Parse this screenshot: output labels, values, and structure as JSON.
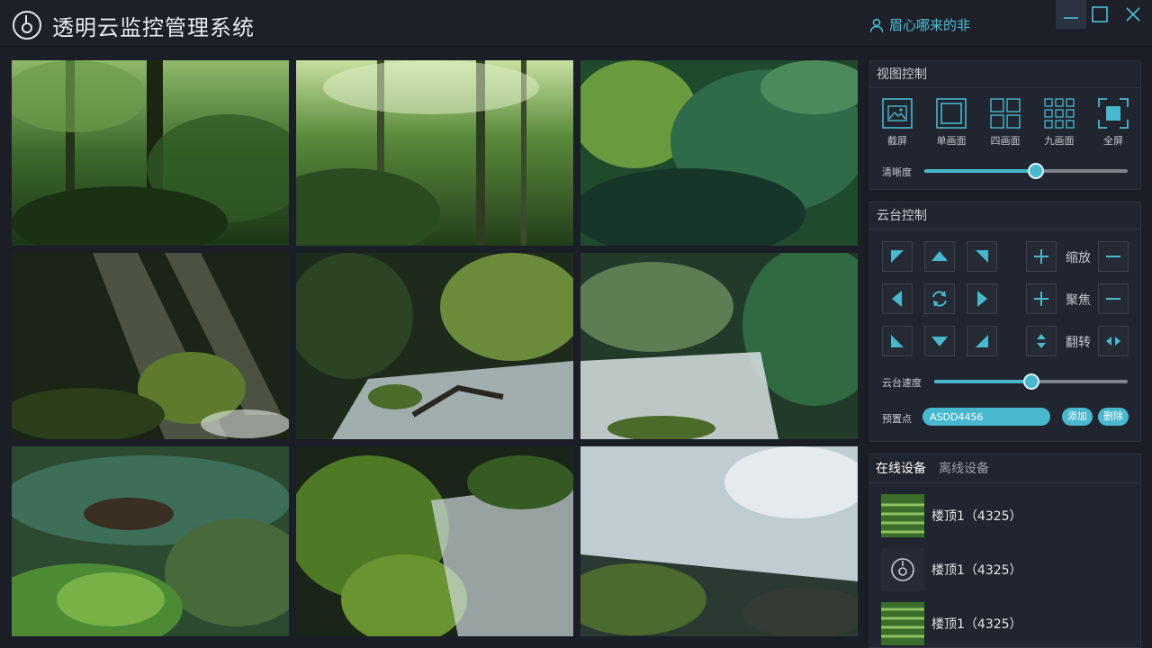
{
  "app": {
    "title": "透明云监控管理系统"
  },
  "user": {
    "name": "眉心哪来的非"
  },
  "view_control": {
    "title": "视图控制",
    "buttons": [
      {
        "label": "截屏",
        "icon": "screenshot-icon"
      },
      {
        "label": "单画面",
        "icon": "single-view-icon"
      },
      {
        "label": "四画面",
        "icon": "four-view-icon"
      },
      {
        "label": "九画面",
        "icon": "nine-view-icon"
      },
      {
        "label": "全屏",
        "icon": "fullscreen-icon"
      }
    ],
    "clarity_label": "清晰度",
    "clarity_value": 0.55
  },
  "ptz": {
    "title": "云台控制",
    "zoom_label": "缩放",
    "focus_label": "聚焦",
    "flip_label": "翻转",
    "speed_label": "云台速度",
    "speed_value": 0.5,
    "preset_label": "预置点",
    "preset_value": "ASDD4456",
    "add_label": "添加",
    "delete_label": "删除"
  },
  "devices": {
    "tabs": [
      "在线设备",
      "离线设备"
    ],
    "active_tab": 0,
    "items": [
      {
        "name": "楼顶1（4325）",
        "thumb": "field"
      },
      {
        "name": "楼顶1（4325）",
        "thumb": "logo"
      },
      {
        "name": "楼顶1（4325）",
        "thumb": "field"
      }
    ]
  },
  "video_grid": {
    "layout": "3x3",
    "cells": 9
  },
  "colors": {
    "accent": "#48b8cf",
    "background": "#1b1e27",
    "panel": "#21252f"
  }
}
